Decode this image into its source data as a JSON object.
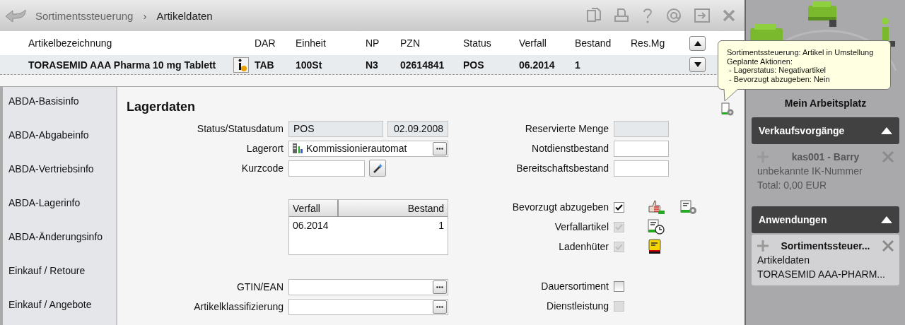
{
  "breadcrumb": {
    "items": [
      "Sortimentssteuerung",
      "Artikeldaten"
    ],
    "separator": "›"
  },
  "article_table": {
    "columns": [
      "Artikelbezeichnung",
      "DAR",
      "Einheit",
      "NP",
      "PZN",
      "Status",
      "Verfall",
      "Bestand",
      "Res.Mg"
    ],
    "row": [
      "TORASEMID AAA Pharma 10 mg Tablett",
      "TAB",
      "100St",
      "N3",
      "02614841",
      "POS",
      "06.2014",
      "1"
    ]
  },
  "tooltip": [
    "Sortimentssteuerung: Artikel in Umstellung",
    "Geplante Aktionen:",
    " - Lagerstatus: Negativartikel",
    " - Bevorzugt abzugeben: Nein"
  ],
  "sidebar": {
    "items": [
      "ABDA-Basisinfo",
      "ABDA-Abgabeinfo",
      "ABDA-Vertriebsinfo",
      "ABDA-Lagerinfo",
      "ABDA-Änderungsinfo",
      "Einkauf / Retoure",
      "Einkauf / Angebote"
    ]
  },
  "form": {
    "title": "Lagerdaten",
    "status": {
      "label": "Status/Statusdatum",
      "value": "POS",
      "date": "02.09.2008"
    },
    "lagerort": {
      "label": "Lagerort",
      "value": "Kommissionierautomat"
    },
    "kurzcode": {
      "label": "Kurzcode"
    },
    "stock_table": {
      "columns": [
        "Verfall",
        "Bestand"
      ],
      "rows": [
        [
          "06.2014",
          "1"
        ]
      ]
    },
    "lookups": [
      {
        "label": "GTIN/EAN"
      },
      {
        "label": "Artikelklassifizierung"
      }
    ],
    "quantities": [
      {
        "label": "Reservierte Menge",
        "disabled": true
      },
      {
        "label": "Notdienstbestand",
        "disabled": false
      },
      {
        "label": "Bereitschaftsbestand",
        "disabled": false
      }
    ],
    "flags": [
      {
        "label": "Bevorzugt abzugeben",
        "checked": true,
        "disabled": false
      },
      {
        "label": "Verfallartikel",
        "checked": true,
        "disabled": true
      },
      {
        "label": "Ladenhüter",
        "checked": true,
        "disabled": true
      }
    ],
    "flags2": [
      {
        "label": "Dauersortiment",
        "checked": false,
        "disabled": false
      },
      {
        "label": "Dienstleistung",
        "checked": false,
        "disabled": true
      }
    ]
  },
  "workplace": {
    "title": "Mein Arbeitsplatz",
    "sections": [
      {
        "title": "Verkaufsvorgänge",
        "expanded": true,
        "items": [
          {
            "title": "kas001 - Barry",
            "lines": [
              "unbekannte IK-Nummer",
              "Total: 0,00 EUR"
            ],
            "active": false
          }
        ]
      },
      {
        "title": "Anwendungen",
        "expanded": true,
        "items": [
          {
            "title": "Sortimentssteuer...",
            "lines": [
              "Artikeldaten",
              "TORASEMID AAA-PHARM..."
            ],
            "active": true
          }
        ]
      }
    ]
  }
}
